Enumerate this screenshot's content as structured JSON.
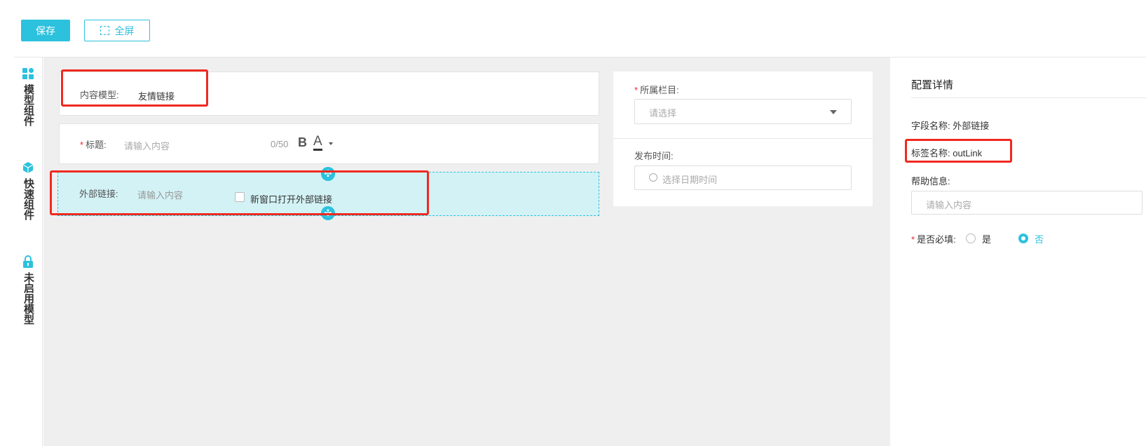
{
  "toolbar": {
    "save_label": "保存",
    "fullscreen_label": "全屏",
    "accent_color": "#2cc1dd"
  },
  "sidebar": {
    "items": [
      {
        "label": "模型组件",
        "icon": "grid-icon"
      },
      {
        "label": "快速组件",
        "icon": "cube-icon"
      },
      {
        "label": "未启用模型",
        "icon": "lock-icon"
      }
    ]
  },
  "form": {
    "model": {
      "label": "内容模型:",
      "value": "友情链接"
    },
    "title": {
      "required_mark": "*",
      "label": "标题:",
      "placeholder": "请输入内容",
      "counter": "0/50",
      "bold_label": "B",
      "color_label": "A"
    },
    "outlink": {
      "label": "外部链接:",
      "placeholder": "请输入内容",
      "checkbox_label": "新窗口打开外部链接",
      "checked": false
    }
  },
  "meta": {
    "category": {
      "required_mark": "*",
      "label": "所属栏目:",
      "placeholder": "请选择"
    },
    "publish_time": {
      "label": "发布时间:",
      "placeholder": "选择日期时间"
    }
  },
  "config": {
    "title": "配置详情",
    "field_name": "字段名称: 外部链接",
    "tag_name": "标签名称: outLink",
    "help_label": "帮助信息:",
    "help_placeholder": "请输入内容",
    "required_mark": "*",
    "required_label": "是否必填:",
    "option_yes": "是",
    "option_no": "否",
    "selected": "否"
  },
  "highlight_color": "#f0291f"
}
